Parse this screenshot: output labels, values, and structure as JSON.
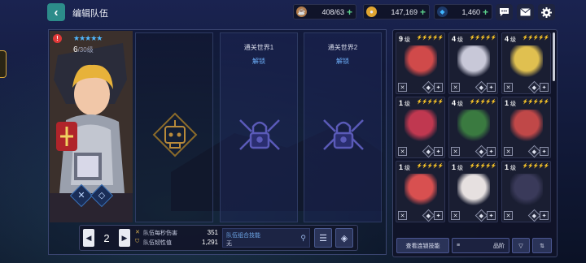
{
  "header": {
    "title": "编辑队伍",
    "resources": [
      {
        "icon": "coffee-cup-icon",
        "value": "408/63",
        "color": "#b07a4a"
      },
      {
        "icon": "gold-coin-icon",
        "value": "147,169",
        "color": "#e0a530"
      },
      {
        "icon": "gem-icon",
        "value": "1,460",
        "color": "#3fb6ff"
      }
    ],
    "plus": "+"
  },
  "hero": {
    "stars": "★★★★★",
    "level": "6",
    "max_level": "/30",
    "max_label": "级",
    "alert": "!"
  },
  "slots": [
    {
      "title": "",
      "unlock": "",
      "locked": false
    },
    {
      "title": "通关世界1",
      "unlock": "解锁",
      "locked": true
    },
    {
      "title": "通关世界2",
      "unlock": "解锁",
      "locked": true
    }
  ],
  "bottom": {
    "page": "2",
    "prev": "◀",
    "next": "▶",
    "dps_label": "队伍每秒伤害",
    "dps_value": "351",
    "toughness_label": "队伍韧性值",
    "toughness_value": "1,291",
    "skill_title": "队伍组合技能",
    "skill_value": "无"
  },
  "roster": [
    {
      "level": "9",
      "unit": "级",
      "bolts": "⚡⚡⚡⚡⚡",
      "bolt_color": "#e6c34a",
      "art": "#d04a4a"
    },
    {
      "level": "4",
      "unit": "级",
      "bolts": "⚡⚡⚡⚡⚡",
      "bolt_color": "#e6c34a",
      "art": "#c8c8d8"
    },
    {
      "level": "4",
      "unit": "级",
      "bolts": "⚡⚡⚡⚡⚡",
      "bolt_color": "#e6c34a",
      "art": "#e0c050"
    },
    {
      "level": "1",
      "unit": "级",
      "bolts": "⚡⚡⚡⚡⚡",
      "bolt_color": "#e6c34a",
      "art": "#c03850"
    },
    {
      "level": "4",
      "unit": "级",
      "bolts": "⚡⚡⚡⚡⚡",
      "bolt_color": "#c060e0",
      "art": "#3a7a40"
    },
    {
      "level": "1",
      "unit": "级",
      "bolts": "⚡⚡⚡⚡⚡",
      "bolt_color": "#c060e0",
      "art": "#c04848"
    },
    {
      "level": "1",
      "unit": "级",
      "bolts": "⚡⚡⚡⚡⚡",
      "bolt_color": "#4fa8f0",
      "art": "#d85050"
    },
    {
      "level": "1",
      "unit": "级",
      "bolts": "⚡⚡⚡⚡⚡",
      "bolt_color": "#4fa8f0",
      "art": "#e6e0e0"
    },
    {
      "level": "1",
      "unit": "级",
      "bolts": "⚡⚡⚡⚡⚡",
      "bolt_color": "#4fa8f0",
      "art": "#3a3a5a"
    }
  ],
  "panel": {
    "chain_skill_label": "查看连锁技能",
    "sort_label": "品阶",
    "sort_icon": "≡",
    "filter_icon": "▽",
    "settings_icon": "⇅"
  }
}
